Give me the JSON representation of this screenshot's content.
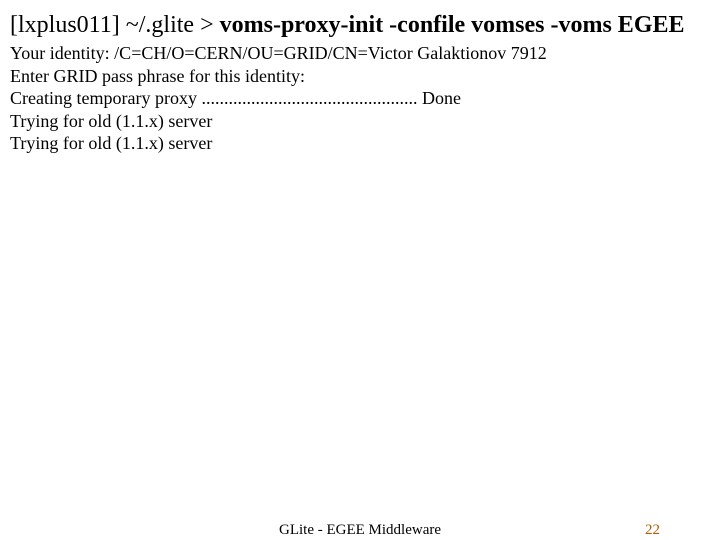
{
  "title": {
    "prompt": "[lxplus011] ~/.glite > ",
    "command": "voms-proxy-init -confile vomses -voms EGEE"
  },
  "lines": {
    "l0": "Your identity: /C=CH/O=CERN/OU=GRID/CN=Victor Galaktionov 7912",
    "l1": "Enter GRID pass phrase for this identity:",
    "l2": "Creating temporary proxy ................................................ Done",
    "l3": "Trying for old (1.1.x) server",
    "l4": "Trying for old (1.1.x) server"
  },
  "footer": {
    "center": "GLite - EGEE Middleware",
    "page": "22"
  }
}
